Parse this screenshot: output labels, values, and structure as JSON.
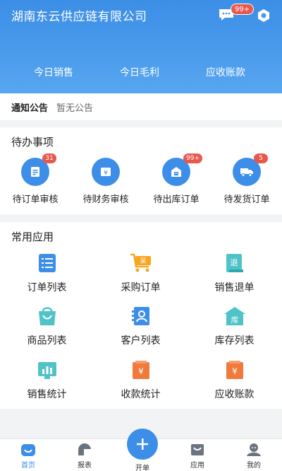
{
  "header": {
    "company": "湖南东云供应链有限公司",
    "message_badge": "99+",
    "stats": [
      "今日销售",
      "今日毛利",
      "应收账款"
    ]
  },
  "notice": {
    "title": "通知公告",
    "text": "暂无公告"
  },
  "todo": {
    "title": "待办事项",
    "items": [
      {
        "label": "待订单审核",
        "badge": "31",
        "icon": "document-icon"
      },
      {
        "label": "待财务审核",
        "badge": "",
        "icon": "yen-box-icon"
      },
      {
        "label": "待出库订单",
        "badge": "99+",
        "icon": "warehouse-icon"
      },
      {
        "label": "待发货订单",
        "badge": "5",
        "icon": "truck-icon"
      }
    ]
  },
  "apps": {
    "title": "常用应用",
    "items": [
      {
        "label": "订单列表",
        "icon": "list-icon"
      },
      {
        "label": "采购订单",
        "icon": "cart-icon",
        "icon_text": "采"
      },
      {
        "label": "销售退单",
        "icon": "return-icon",
        "icon_text": "退"
      },
      {
        "label": "商品列表",
        "icon": "bag-icon"
      },
      {
        "label": "客户列表",
        "icon": "contact-card-icon"
      },
      {
        "label": "库存列表",
        "icon": "warehouse-icon",
        "icon_text": "库"
      },
      {
        "label": "销售统计",
        "icon": "bar-chart-icon"
      },
      {
        "label": "收款统计",
        "icon": "yen-receipt-icon",
        "icon_text": "¥"
      },
      {
        "label": "应收账款",
        "icon": "yen-receipt-icon",
        "icon_text": "¥"
      }
    ]
  },
  "tabbar": {
    "home": "首页",
    "report": "报表",
    "create": "开单",
    "apps": "应用",
    "mine": "我的"
  },
  "colors": {
    "primary": "#3d8ee8",
    "badge": "#e8584d",
    "header_gradient_top": "#3c8ee6",
    "teal": "#4fc3c8",
    "orange": "#f07a3c"
  }
}
